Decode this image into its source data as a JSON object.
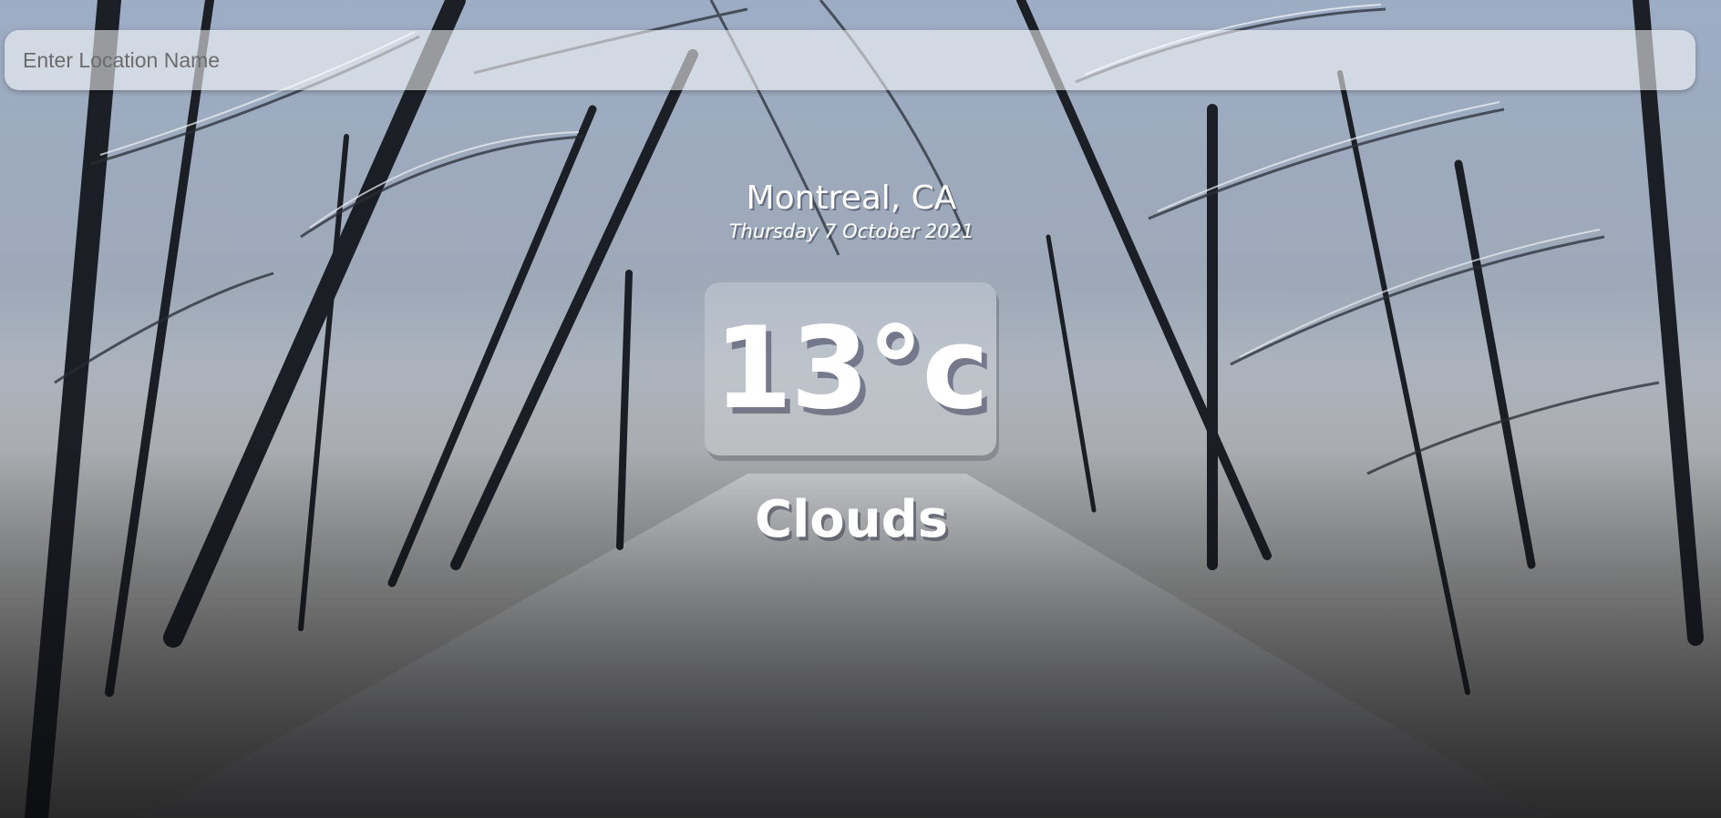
{
  "search": {
    "placeholder": "Enter Location Name",
    "value": ""
  },
  "location": {
    "name": "Montreal, CA",
    "date": "Thursday 7 October 2021"
  },
  "weather": {
    "temperature": "13°c",
    "condition": "Clouds"
  },
  "theme": {
    "text_color": "#ffffff",
    "background": "snowy forest"
  }
}
